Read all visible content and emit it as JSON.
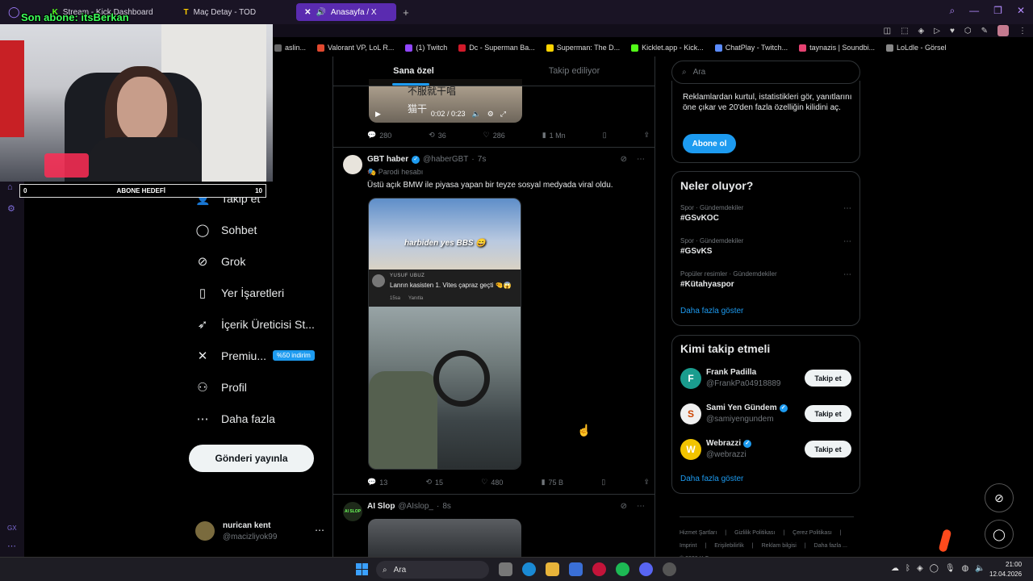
{
  "browser": {
    "tabs": [
      {
        "label": "Stream - Kick Dashboard",
        "icon": "kick-icon"
      },
      {
        "label": "Maç Detay - TOD",
        "icon": "tod-icon"
      },
      {
        "label": "Anasayfa / X",
        "icon": "x-icon",
        "active": true
      }
    ],
    "bookmarks": [
      {
        "label": "aslin...",
        "color": "#666666"
      },
      {
        "label": "Valorant VP, LoL R...",
        "color": "#e2492f"
      },
      {
        "label": "(1) Twitch",
        "color": "#9146ff"
      },
      {
        "label": "Dc - Superman Ba...",
        "color": "#d11a2a"
      },
      {
        "label": "Superman: The D...",
        "color": "#ffd400"
      },
      {
        "label": "Kicklet.app - Kick...",
        "color": "#53fc18"
      },
      {
        "label": "ChatPlay - Twitch...",
        "color": "#5b8cff"
      },
      {
        "label": "taynazis | Soundbi...",
        "color": "#e64272"
      },
      {
        "label": "LoLdle - Görsel",
        "color": "#888888"
      }
    ]
  },
  "overlay": {
    "son_abone": "Son abone: itsBerkan",
    "goal_left": "0",
    "goal_label": "ABONE HEDEFİ",
    "goal_right": "10"
  },
  "nav": {
    "items": [
      {
        "label": "Takip et",
        "icon": "follow-icon",
        "glyph": "👤"
      },
      {
        "label": "Sohbet",
        "icon": "chat-icon",
        "glyph": "◯"
      },
      {
        "label": "Grok",
        "icon": "grok-icon",
        "glyph": "⊘"
      },
      {
        "label": "Yer İşaretleri",
        "icon": "bookmark-icon",
        "glyph": "▯"
      },
      {
        "label": "İçerik Üreticisi St...",
        "icon": "rocket-icon",
        "glyph": "➶"
      },
      {
        "label": "Premiu...",
        "icon": "x-logo-icon",
        "glyph": "✕"
      },
      {
        "label": "Profil",
        "icon": "profile-icon",
        "glyph": "⚇"
      },
      {
        "label": "Daha fazla",
        "icon": "more-circle-icon",
        "glyph": "⋯"
      }
    ],
    "promo": "%50 indirim",
    "post_button": "Gönderi yayınla",
    "account": {
      "name": "nurican kent",
      "handle": "@macizliyok99"
    }
  },
  "feed": {
    "tabs": [
      "Sana özel",
      "Takip ediliyor"
    ],
    "video_top": {
      "text1": "不服就干唱",
      "text2": "猫干",
      "time": "0:02 / 0:23"
    },
    "post0_actions": {
      "replies": "280",
      "reposts": "36",
      "likes": "286",
      "views": "1 Mn"
    },
    "post1": {
      "name": "GBT haber",
      "handle": "@haberGBT",
      "time": "7s",
      "label": "Parodi hesabı",
      "text": "Üstü açık BMW ile piyasa yapan bir teyze sosyal medyada viral oldu.",
      "media_caption": "harbiden yes BBS 😄",
      "comment_user": "YUSUF UBUZ",
      "comment_text": "Lanrın kasisten 1. Vites çapraz geçti 🤏😱",
      "comment_age": "15sa",
      "comment_reply": "Yanıtla",
      "replies": "13",
      "reposts": "15",
      "likes": "480",
      "views": "75 B"
    },
    "post2": {
      "name": "AI Slop",
      "handle": "@AIslop_",
      "time": "8s",
      "avatar_text": "AI SLOP"
    }
  },
  "sidebar": {
    "search_placeholder": "Ara",
    "premium_text": "Reklamlardan kurtul, istatistikleri gör, yanıtlarını öne çıkar ve 20'den fazla özelliğin kilidini aç.",
    "premium_button": "Abone ol",
    "trends_title": "Neler oluyor?",
    "trends": [
      {
        "meta": "Spor · Gündemdekiler",
        "tag": "#GSvKOC"
      },
      {
        "meta": "Spor · Gündemdekiler",
        "tag": "#GSvKS"
      },
      {
        "meta": "Popüler resimler · Gündemdekiler",
        "tag": "#Kütahyaspor"
      }
    ],
    "show_more": "Daha fazla göster",
    "who_title": "Kimi takip etmeli",
    "who": [
      {
        "name": "Frank Padilla",
        "handle": "@FrankPa04918889",
        "avatar": "F",
        "color": "#1a9c8e",
        "verified": false
      },
      {
        "name": "Sami Yen Gündem",
        "handle": "@samiyengundem",
        "avatar": "S",
        "color": "#f0f0f0",
        "verified": true
      },
      {
        "name": "Webrazzi",
        "handle": "@webrazzi",
        "avatar": "W",
        "color": "#f2c400",
        "verified": true
      }
    ],
    "follow_label": "Takip et",
    "footer": [
      "Hizmet Şartları",
      "|",
      "Gizlilik Politikası",
      "|",
      "Çerez Politikası",
      "|",
      "Imprint",
      "|",
      "Erişilebilirlik",
      "|",
      "Reklam bilgisi",
      "|",
      "Daha fazla ...",
      "© 2026 X Corp."
    ]
  },
  "taskbar": {
    "search": "Ara",
    "time": "21:00",
    "date": "12.04.2026"
  }
}
